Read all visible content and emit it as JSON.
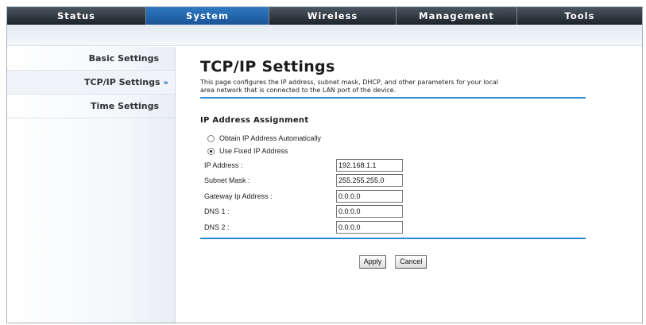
{
  "nav": {
    "tabs": [
      {
        "label": "Status",
        "width": 175
      },
      {
        "label": "System",
        "width": 155
      },
      {
        "label": "Wireless",
        "width": 160
      },
      {
        "label": "Management",
        "width": 152
      },
      {
        "label": "Tools",
        "width": 157
      }
    ],
    "active_index": 1
  },
  "sidebar": {
    "items": [
      {
        "label": "Basic Settings"
      },
      {
        "label": "TCP/IP Settings",
        "arrow": "»"
      },
      {
        "label": "Time Settings"
      }
    ]
  },
  "main": {
    "title": "TCP/IP Settings",
    "description_line1": "This page configures the IP address, subnet mask, DHCP, and other parameters for your local",
    "description_line2": "area network that is connected to the LAN port of the device.",
    "section_title": "IP Address Assignment",
    "radio_auto": "Obtain IP Address Automatically",
    "radio_fixed": "Use Fixed IP Address",
    "selected_mode": "fixed",
    "fields": {
      "ip_label": "IP Address :",
      "ip_value": "192.168.1.1",
      "subnet_label": "Subnet Mask :",
      "subnet_value": "255.255.255.0",
      "gateway_label": "Gateway Ip Address :",
      "gateway_value": "0.0.0.0",
      "dns1_label": "DNS 1 :",
      "dns1_value": "0.0.0.0",
      "dns2_label": "DNS 2 :",
      "dns2_value": "0.0.0.0"
    },
    "apply_label": "Apply",
    "cancel_label": "Cancel"
  },
  "colors": {
    "accent_blue": "#2a8ad2",
    "nav_dark": "#1f262d",
    "nav_active": "#1a5596"
  }
}
